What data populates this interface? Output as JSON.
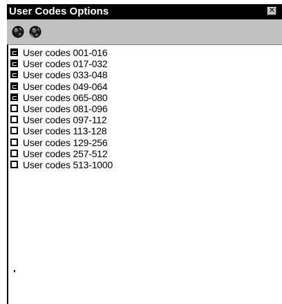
{
  "window": {
    "title": "User Codes Options",
    "close_glyph": "✕"
  },
  "toolbar": {
    "left_icon": "globe-back-icon",
    "right_icon": "globe-forward-icon"
  },
  "colors": {
    "titlebar": "#000000",
    "toolbar": "#c0c0c0",
    "list_background": "#ffffff"
  },
  "list": {
    "items": [
      {
        "label": "User codes 001-016",
        "checked": true
      },
      {
        "label": "User codes 017-032",
        "checked": true
      },
      {
        "label": "User codes 033-048",
        "checked": true
      },
      {
        "label": "User codes 049-064",
        "checked": true
      },
      {
        "label": "User codes 065-080",
        "checked": true
      },
      {
        "label": "User codes 081-096",
        "checked": false
      },
      {
        "label": "User codes 097-112",
        "checked": false
      },
      {
        "label": "User codes 113-128",
        "checked": false
      },
      {
        "label": "User codes 129-256",
        "checked": false
      },
      {
        "label": "User codes 257-512",
        "checked": false
      },
      {
        "label": "User codes 513-1000",
        "checked": false
      }
    ]
  }
}
